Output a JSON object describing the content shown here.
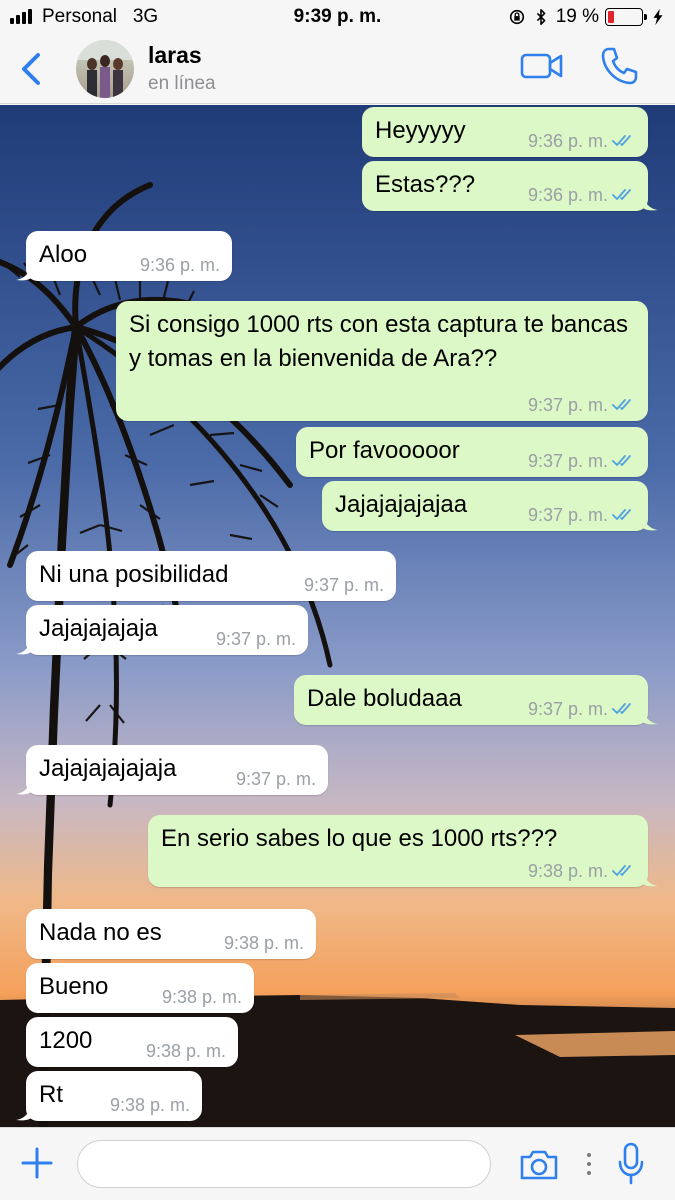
{
  "status_bar": {
    "carrier": "Personal",
    "network": "3G",
    "time": "9:39 p. m.",
    "battery_text": "19 %",
    "battery_level": 0.19,
    "battery_color": "#e0242b"
  },
  "header": {
    "contact_name": "laras",
    "contact_status": "en línea",
    "accent_color": "#2f80ed",
    "icons": [
      "back-chevron-icon",
      "video-call-icon",
      "phone-icon"
    ]
  },
  "messages": [
    {
      "dir": "out",
      "text": "Heyyyyy",
      "time": "9:36 p. m.",
      "read": true
    },
    {
      "dir": "out",
      "text": "Estas???",
      "time": "9:36 p. m.",
      "read": true
    },
    {
      "dir": "in",
      "text": "Aloo",
      "time": "9:36 p. m."
    },
    {
      "dir": "out",
      "text": "Si consigo 1000 rts con esta captura te bancas y tomas en la bienvenida de Ara??",
      "time": "9:37 p. m.",
      "read": true
    },
    {
      "dir": "out",
      "text": "Por favooooor",
      "time": "9:37 p. m.",
      "read": true
    },
    {
      "dir": "out",
      "text": "Jajajajajajaa",
      "time": "9:37 p. m.",
      "read": true
    },
    {
      "dir": "in",
      "text": "Ni una posibilidad",
      "time": "9:37 p. m."
    },
    {
      "dir": "in",
      "text": "Jajajajajaja",
      "time": "9:37 p. m."
    },
    {
      "dir": "out",
      "text": "Dale boludaaa",
      "time": "9:37 p. m.",
      "read": true
    },
    {
      "dir": "in",
      "text": "Jajajajajajaja",
      "time": "9:37 p. m."
    },
    {
      "dir": "out",
      "text": "En serio sabes lo que es 1000 rts???",
      "time": "9:38 p. m.",
      "read": true
    },
    {
      "dir": "in",
      "text": "Nada no es",
      "time": "9:38 p. m."
    },
    {
      "dir": "in",
      "text": "Bueno",
      "time": "9:38 p. m."
    },
    {
      "dir": "in",
      "text": "1200",
      "time": "9:38 p. m."
    },
    {
      "dir": "in",
      "text": "Rt",
      "time": "9:38 p. m."
    }
  ],
  "colors": {
    "outgoing_bubble": "#dcf8c6",
    "incoming_bubble": "#ffffff",
    "read_tick": "#4fa3e0"
  },
  "input_bar": {
    "placeholder": "",
    "icons": [
      "plus-icon",
      "camera-icon",
      "more-dots-icon",
      "microphone-icon"
    ]
  }
}
